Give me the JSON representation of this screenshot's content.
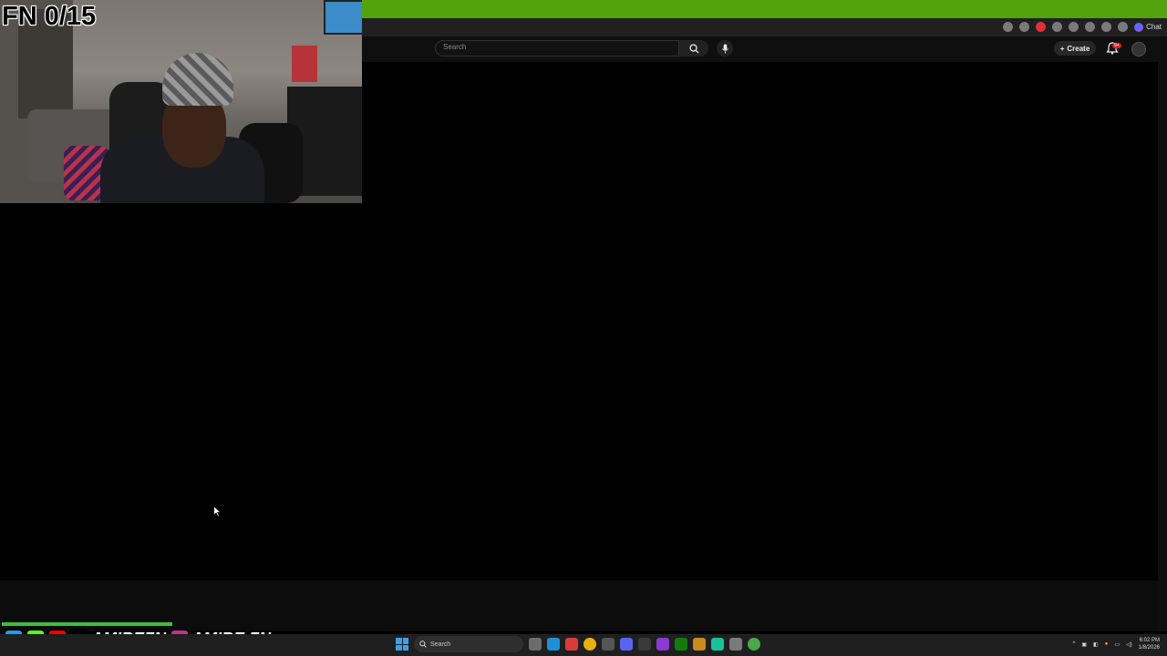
{
  "overlay": {
    "counter_text": "FN 0/15",
    "social_handles": [
      "AMIREFN",
      "AMIRE.FN"
    ],
    "social_icons": [
      "twitter-icon",
      "kick-icon",
      "youtube-icon",
      "tiktok-icon",
      "instagram-icon"
    ]
  },
  "browser": {
    "tab_strip_color": "#53a30f",
    "chat_label": "Chat",
    "extension_badge_color": "#e0303a"
  },
  "youtube": {
    "search_placeholder": "Search",
    "create_label": "Create",
    "notification_badge": "9+"
  },
  "taskbar": {
    "search_label": "Search",
    "clock_time": "6:02 PM",
    "clock_date": "1/8/2026"
  }
}
